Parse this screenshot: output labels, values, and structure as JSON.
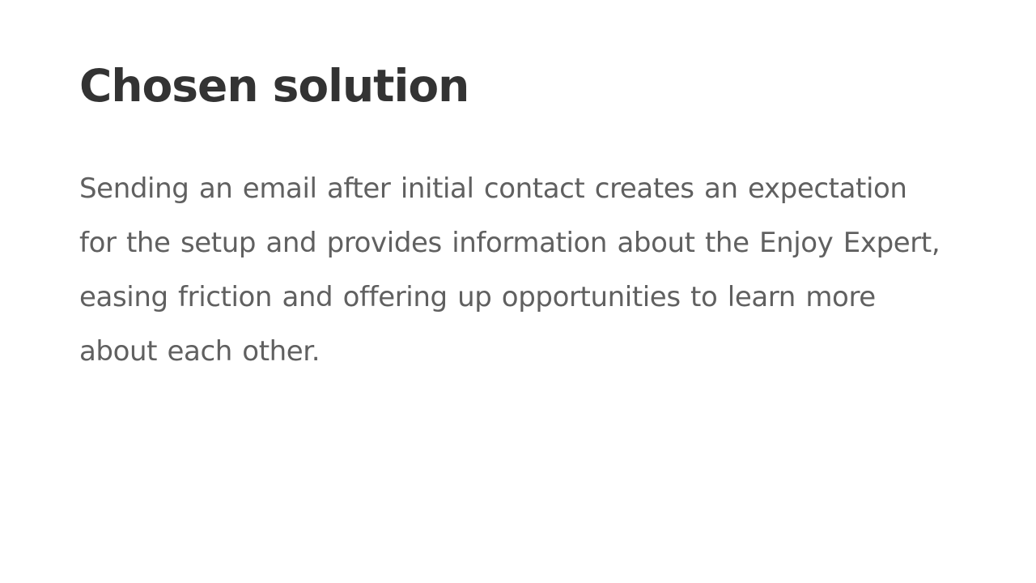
{
  "slide": {
    "title": "Chosen solution",
    "body": "Sending an email after initial contact creates an expectation for the setup and provides information about the Enjoy Expert, easing friction and offering up opportunities to learn more about each other."
  }
}
